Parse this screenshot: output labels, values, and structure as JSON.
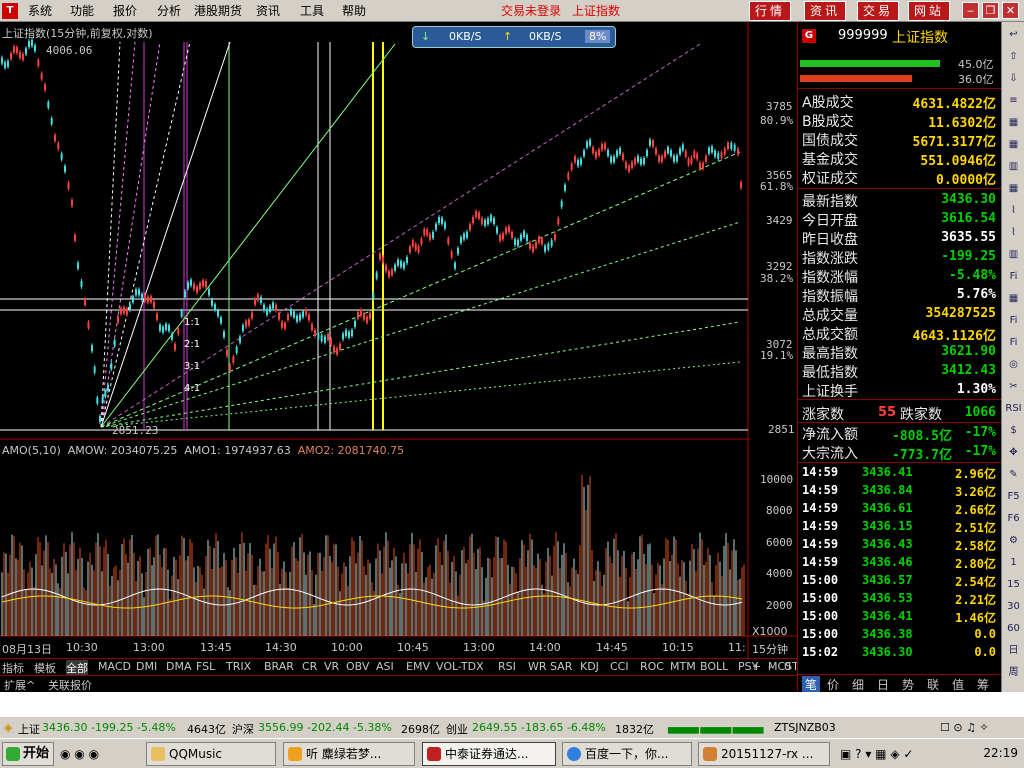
{
  "menubar": {
    "items": [
      "系统",
      "功能",
      "报价",
      "分析",
      "港股期货",
      "资讯",
      "工具",
      "帮助"
    ],
    "trade_status": "交易未登录",
    "trade_index": "上证指数",
    "right_buttons": [
      "行情",
      "资讯",
      "交易",
      "网站"
    ]
  },
  "chart": {
    "title": "上证指数(15分钟,前复权,对数)",
    "speed": {
      "down": "0KB/S",
      "up": "0KB/S",
      "pct": "8%"
    },
    "high_label": "4006.06",
    "low_label": "2851.23",
    "price_ticks": [
      "3785",
      "3565",
      "3429",
      "3292",
      "3072",
      "2851"
    ],
    "pct_ticks": [
      "80.9%",
      "61.8%",
      "38.2%",
      "19.1%"
    ],
    "ratio_labels": [
      "1:1",
      "2:1",
      "3:1",
      "4:1"
    ],
    "amo": {
      "name": "AMO(5,10)",
      "amow": "AMOW: 2034075.25",
      "amo1": "AMO1: 1974937.63",
      "amo2": "AMO2: 2081740.75"
    },
    "vol_ticks": [
      "10000",
      "8000",
      "6000",
      "4000",
      "2000"
    ],
    "x1000": "X1000",
    "x_ticks": [
      "08月13日",
      "10:30",
      "13:00",
      "13:45",
      "14:30",
      "10:00",
      "10:45",
      "13:00",
      "14:00",
      "14:45",
      "10:15",
      "11:"
    ],
    "period": "15分钟",
    "colors": {
      "candle_up": "#ff4040",
      "candle_down": "#40e0e0",
      "fib": "#ffff66",
      "fan": "#88ff88"
    }
  },
  "indicator_tabs": [
    "指标",
    "模板",
    "全部",
    "MACD",
    "DMI",
    "DMA",
    "FSL",
    "TRIX",
    "BRAR",
    "CR",
    "VR",
    "OBV",
    "ASI",
    "EMV",
    "VOL-TDX",
    "RSI",
    "WR",
    "SAR",
    "KDJ",
    "CCI",
    "ROC",
    "MTM",
    "BOLL",
    "PSY",
    "MCST"
  ],
  "indicator_tabs_right": [
    "+",
    "-",
    "0"
  ],
  "ext_tabs": [
    "扩展^",
    "关联报价"
  ],
  "panel": {
    "code": "999999",
    "name": "上证指数",
    "bar1_label": "45.0亿",
    "bar2_label": "36.0亿",
    "turnover": [
      {
        "label": "A股成交",
        "value": "4631.4822亿"
      },
      {
        "label": "B股成交",
        "value": "11.6302亿"
      },
      {
        "label": "国债成交",
        "value": "5671.3177亿"
      },
      {
        "label": "基金成交",
        "value": "551.0946亿"
      },
      {
        "label": "权证成交",
        "value": "0.0000亿"
      }
    ],
    "quotes": [
      {
        "label": "最新指数",
        "value": "3436.30",
        "color": "grn"
      },
      {
        "label": "今日开盘",
        "value": "3616.54",
        "color": "grn"
      },
      {
        "label": "昨日收盘",
        "value": "3635.55",
        "color": "wht"
      },
      {
        "label": "指数涨跌",
        "value": "-199.25",
        "color": "grn"
      },
      {
        "label": "指数涨幅",
        "value": "-5.48%",
        "color": "grn"
      },
      {
        "label": "指数振幅",
        "value": "5.76%",
        "color": "wht"
      },
      {
        "label": "总成交量",
        "value": "354287525",
        "color": "yel"
      },
      {
        "label": "总成交额",
        "value": "4643.1126亿",
        "color": "yel"
      },
      {
        "label": "最高指数",
        "value": "3621.90",
        "color": "grn"
      },
      {
        "label": "最低指数",
        "value": "3412.43",
        "color": "grn"
      },
      {
        "label": "上证换手",
        "value": "1.30%",
        "color": "wht"
      }
    ],
    "up_label": "涨家数",
    "up_count": "55",
    "down_label": "跌家数",
    "down_count": "1066",
    "flows": [
      {
        "label": "净流入额",
        "value": "-808.5亿",
        "pct": "-17%"
      },
      {
        "label": "大宗流入",
        "value": "-773.7亿",
        "pct": "-17%"
      }
    ],
    "ticks": [
      {
        "time": "14:59",
        "price": "3436.41",
        "vol": "2.96亿"
      },
      {
        "time": "14:59",
        "price": "3436.84",
        "vol": "3.26亿"
      },
      {
        "time": "14:59",
        "price": "3436.61",
        "vol": "2.66亿"
      },
      {
        "time": "14:59",
        "price": "3436.15",
        "vol": "2.51亿"
      },
      {
        "time": "14:59",
        "price": "3436.43",
        "vol": "2.58亿"
      },
      {
        "time": "14:59",
        "price": "3436.46",
        "vol": "2.80亿"
      },
      {
        "time": "15:00",
        "price": "3436.57",
        "vol": "2.54亿"
      },
      {
        "time": "15:00",
        "price": "3436.53",
        "vol": "2.21亿"
      },
      {
        "time": "15:00",
        "price": "3436.41",
        "vol": "1.46亿"
      },
      {
        "time": "15:00",
        "price": "3436.38",
        "vol": "0.0"
      },
      {
        "time": "15:02",
        "price": "3436.30",
        "vol": "0.0"
      }
    ],
    "tabs": [
      "笔",
      "价",
      "细",
      "日",
      "势",
      "联",
      "值",
      "筹"
    ]
  },
  "vtoolbar": [
    "↩",
    "⇧",
    "⇩",
    "≡",
    "▦",
    "▦",
    "▥",
    "▦",
    "⌇",
    "⌇",
    "▥",
    "Fi",
    "▦",
    "Fi",
    "Fi",
    "◎",
    "✂",
    "RSI",
    "$",
    "✥",
    "✎",
    "F5",
    "F6",
    "⚙",
    "1",
    "15",
    "30",
    "60",
    "日",
    "周"
  ],
  "status": {
    "sh_name": "上证",
    "sh_value": "3436.30 -199.25 -5.48%",
    "sh_amt": "4643亿",
    "sz_name": "沪深",
    "sz_value": "3556.99 -202.44 -5.38%",
    "sz_amt": "2698亿",
    "cy_name": "创业",
    "cy_value": "2649.55 -183.65 -6.48%",
    "cy_amt": "1832亿",
    "code": "ZTSJNZB03"
  },
  "taskbar": {
    "start": "开始",
    "tasks": [
      "QQMusic",
      "听    麋绿若梦...",
      "中泰证券通达...",
      "百度一下，你...",
      "20151127-rx ..."
    ],
    "clock": "22:19"
  }
}
